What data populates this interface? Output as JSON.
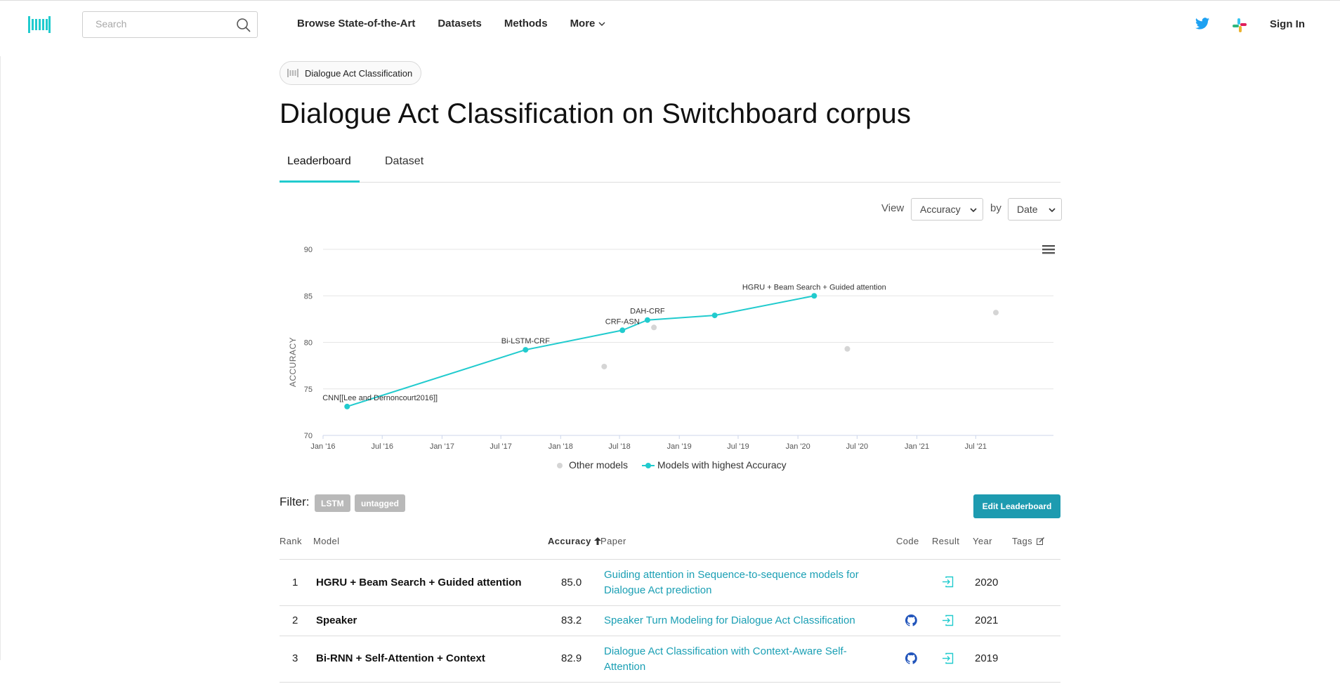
{
  "nav": {
    "search_placeholder": "Search",
    "links": [
      "Browse State-of-the-Art",
      "Datasets",
      "Methods",
      "More"
    ],
    "sign_in": "Sign In"
  },
  "breadcrumb": {
    "label": "Dialogue Act Classification"
  },
  "title": "Dialogue Act Classification on Switchboard corpus",
  "tabs": [
    {
      "label": "Leaderboard",
      "active": true
    },
    {
      "label": "Dataset",
      "active": false
    }
  ],
  "view": {
    "view_label": "View",
    "metric": "Accuracy",
    "by_label": "by",
    "axis": "Date"
  },
  "chart_data": {
    "type": "scatter",
    "ylabel": "ACCURACY",
    "ylim": [
      70,
      90
    ],
    "yticks": [
      70,
      75,
      80,
      85,
      90
    ],
    "xticks": [
      "Jan '16",
      "Jul '16",
      "Jan '17",
      "Jul '17",
      "Jan '18",
      "Jul '18",
      "Jan '19",
      "Jul '19",
      "Jan '20",
      "Jul '20",
      "Jan '21",
      "Jul '21"
    ],
    "grid": true,
    "legend_position": "bottom",
    "series": [
      {
        "name": "Other models",
        "color": "#d5d5d5",
        "points": [
          {
            "x": "2018-05-15",
            "y": 77.4
          },
          {
            "x": "2018-10-15",
            "y": 81.6
          },
          {
            "x": "2020-06-01",
            "y": 79.3
          },
          {
            "x": "2021-09-01",
            "y": 83.2
          }
        ]
      },
      {
        "name": "Models with highest Accuracy",
        "color": "#21cbce",
        "points": [
          {
            "x": "2016-03-15",
            "y": 73.1,
            "label": "CNN[[Lee and Dernoncourt2016]]"
          },
          {
            "x": "2017-09-15",
            "y": 79.2,
            "label": "Bi-LSTM-CRF"
          },
          {
            "x": "2018-07-10",
            "y": 81.3,
            "label": "CRF-ASN"
          },
          {
            "x": "2018-09-25",
            "y": 82.4,
            "label": "DAH-CRF"
          },
          {
            "x": "2019-04-20",
            "y": 82.9,
            "label": ""
          },
          {
            "x": "2020-02-20",
            "y": 85.0,
            "label": "HGRU + Beam Search + Guided attention"
          }
        ]
      }
    ]
  },
  "filter": {
    "label": "Filter:",
    "tags": [
      "LSTM",
      "untagged"
    ]
  },
  "edit_button": "Edit Leaderboard",
  "table": {
    "headers": {
      "rank": "Rank",
      "model": "Model",
      "accuracy": "Accuracy",
      "paper": "Paper",
      "code": "Code",
      "result": "Result",
      "year": "Year",
      "tags": "Tags"
    },
    "rows": [
      {
        "rank": "1",
        "model": "HGRU + Beam Search + Guided attention",
        "accuracy": "85.0",
        "paper": "Guiding attention in Sequence-to-sequence models for Dialogue Act prediction",
        "code": false,
        "year": "2020"
      },
      {
        "rank": "2",
        "model": "Speaker",
        "accuracy": "83.2",
        "paper": "Speaker Turn Modeling for Dialogue Act Classification",
        "code": true,
        "year": "2021"
      },
      {
        "rank": "3",
        "model": "Bi-RNN + Self-Attention + Context",
        "accuracy": "82.9",
        "paper": "Dialogue Act Classification with Context-Aware Self-Attention",
        "code": true,
        "year": "2019"
      }
    ]
  }
}
